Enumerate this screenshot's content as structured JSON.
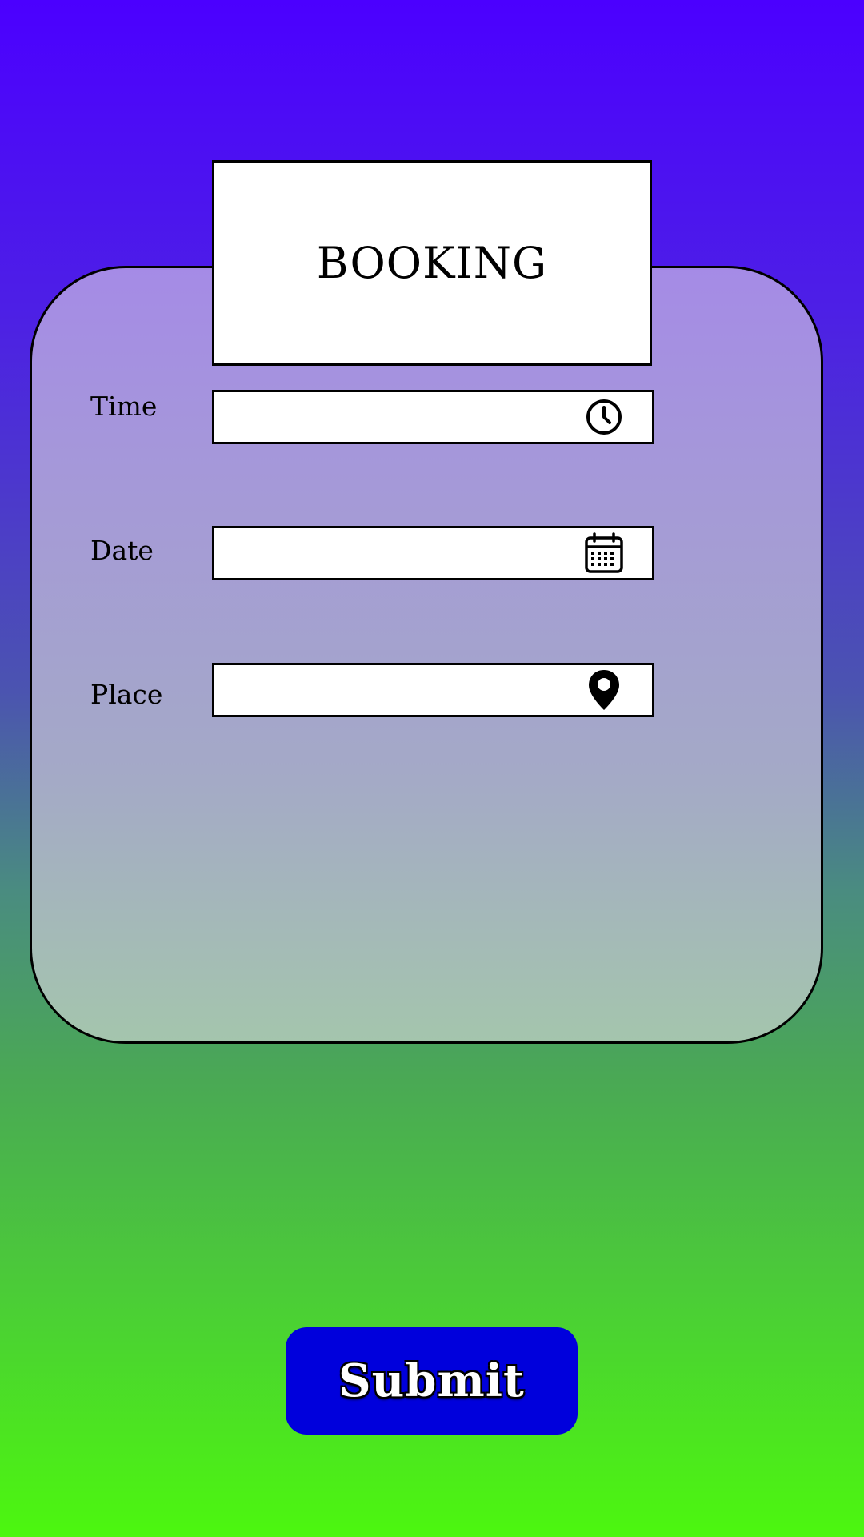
{
  "form": {
    "title": "BOOKING",
    "fields": [
      {
        "label": "Time",
        "icon": "clock-icon",
        "value": "",
        "placeholder": ""
      },
      {
        "label": "Date",
        "icon": "calendar-icon",
        "value": "",
        "placeholder": ""
      },
      {
        "label": "Place",
        "icon": "map-pin-icon",
        "value": "",
        "placeholder": ""
      }
    ],
    "submit_label": "Submit"
  },
  "colors": {
    "background_top": "#4b00ff",
    "background_bottom": "#4cf70f",
    "card_top": "#a58be6",
    "card_bottom": "#a4c5ad",
    "submit_button": "#0000dc"
  }
}
